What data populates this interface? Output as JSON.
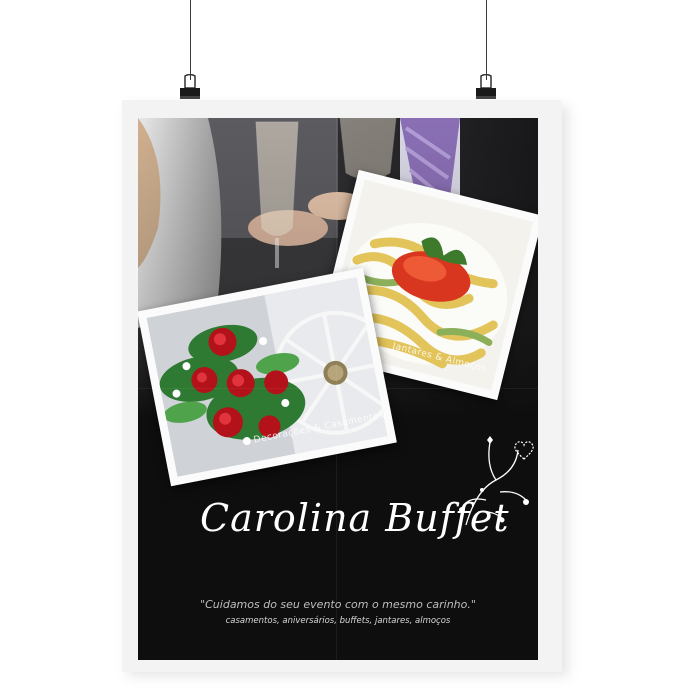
{
  "poster": {
    "title": "Carolina Buffet",
    "tagline": "\"Cuidamos do seu evento com o mesmo carinho.\"",
    "services": "casamentos, aniversários, buffets, jantares, almoços"
  },
  "photos": [
    {
      "id": "pasta",
      "caption": "Jantares & Almoços"
    },
    {
      "id": "bouquet",
      "caption": "Decorações & Casamentos"
    }
  ],
  "colors": {
    "background": "#ffffff",
    "poster_art": "#0e0e0e",
    "text": "#ffffff",
    "tagline": "#bdbdbd"
  },
  "icons": [
    "binder-clip-icon",
    "floral-ornament-icon",
    "heart-ornament-icon"
  ]
}
